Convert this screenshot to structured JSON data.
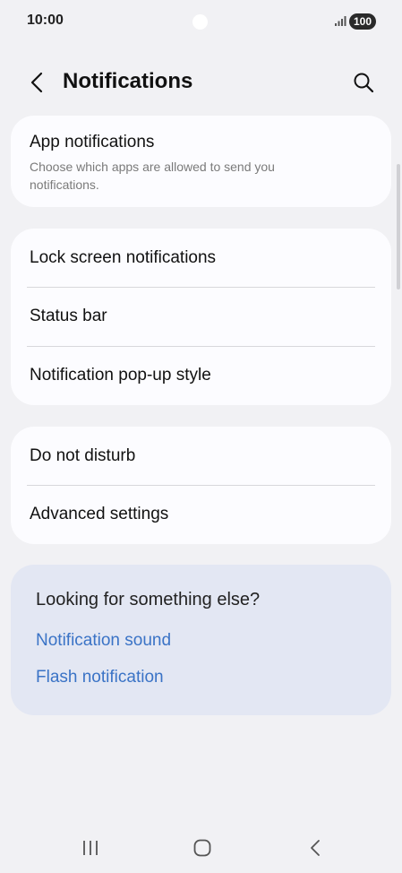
{
  "status_bar": {
    "time": "10:00",
    "battery": "100",
    "icons": [
      "signal-icon",
      "battery-icon"
    ]
  },
  "header": {
    "title": "Notifications",
    "back_icon": "chevron-left-icon",
    "search_icon": "search-icon"
  },
  "sections": {
    "app_notifications": {
      "title": "App notifications",
      "subtitle": "Choose which apps are allowed to send you notifications."
    },
    "lock_screen": {
      "title": "Lock screen notifications"
    },
    "status_bar": {
      "title": "Status bar"
    },
    "popup_style": {
      "title": "Notification pop-up style"
    },
    "do_not_disturb": {
      "title": "Do not disturb"
    },
    "advanced": {
      "title": "Advanced settings"
    }
  },
  "suggestions": {
    "title": "Looking for something else?",
    "links": [
      "Notification sound",
      "Flash notification"
    ]
  },
  "nav_bar": {
    "icons": [
      "recents-icon",
      "home-icon",
      "back-icon"
    ]
  },
  "colors": {
    "background": "#f1f1f4",
    "card": "#fcfcff",
    "suggestion_card": "#e3e7f3",
    "link": "#3a73c6"
  }
}
